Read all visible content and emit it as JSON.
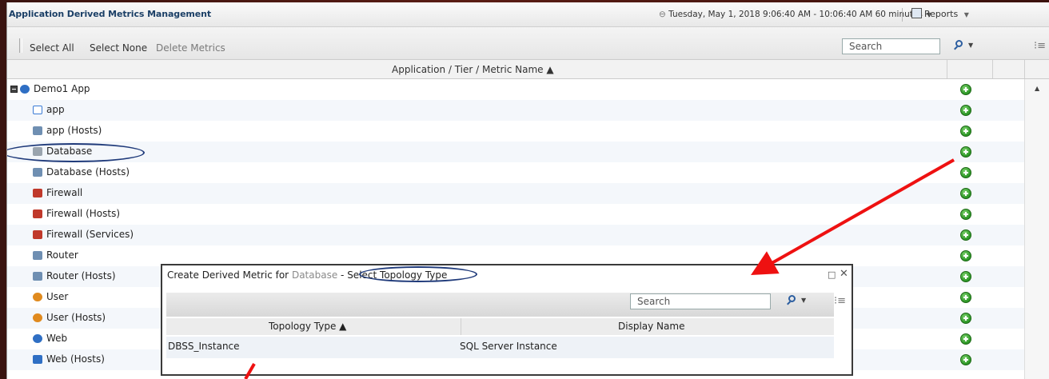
{
  "window": {
    "title": "Application Derived Metrics Management",
    "time_range": "Tuesday, May 1, 2018 9:06:40 AM - 10:06:40 AM 60 minutes",
    "time_arrow": "▼",
    "reports_label": "Reports",
    "reports_arrow": "▼"
  },
  "toolbar": {
    "select_all": "Select All",
    "select_none": "Select None",
    "delete_metrics": "Delete Metrics",
    "search_placeholder": "Search",
    "search_dropdown": "▼",
    "columns_icon": "⁝≡"
  },
  "table": {
    "header": "Application / Tier / Metric Name ▲",
    "rows": [
      {
        "label": "Demo1 App",
        "icon": "globe-icon",
        "color": "#2f6fc4"
      },
      {
        "label": "app",
        "icon": "window-icon",
        "color": "#3a7bd5"
      },
      {
        "label": "app (Hosts)",
        "icon": "host-icon",
        "color": "#6f8fb2"
      },
      {
        "label": "Database",
        "icon": "database-icon",
        "color": "#9aa4ae"
      },
      {
        "label": "Database (Hosts)",
        "icon": "host-icon",
        "color": "#6f8fb2"
      },
      {
        "label": "Firewall",
        "icon": "firewall-icon",
        "color": "#c0392b"
      },
      {
        "label": "Firewall (Hosts)",
        "icon": "firewall-icon",
        "color": "#c0392b"
      },
      {
        "label": "Firewall (Services)",
        "icon": "firewall-icon",
        "color": "#c0392b"
      },
      {
        "label": "Router",
        "icon": "router-icon",
        "color": "#6f8fb2"
      },
      {
        "label": "Router (Hosts)",
        "icon": "router-icon",
        "color": "#6f8fb2"
      },
      {
        "label": "User",
        "icon": "user-icon",
        "color": "#e08a1e"
      },
      {
        "label": "User (Hosts)",
        "icon": "user-icon",
        "color": "#e08a1e"
      },
      {
        "label": "Web",
        "icon": "globe-icon",
        "color": "#2f6fc4"
      },
      {
        "label": "Web (Hosts)",
        "icon": "host-icon",
        "color": "#2f6fc4"
      }
    ]
  },
  "dialog": {
    "title_prefix": "Create Derived Metric for",
    "title_object": "Database",
    "title_suffix": "- Select Topology Type",
    "restore_icon": "□",
    "close_icon": "✕",
    "search_placeholder": "Search",
    "search_dropdown": "▼",
    "columns_icon": "⁝≡",
    "columns": [
      "Topology Type ▲",
      "Display Name"
    ],
    "rows": [
      {
        "topology_type": "DBSS_Instance",
        "display_name": "SQL Server Instance"
      }
    ]
  },
  "colors": {
    "highlight_ellipse": "#1f3a7a",
    "annotation_arrow": "#ee1111",
    "add_button": "#2a9424"
  }
}
